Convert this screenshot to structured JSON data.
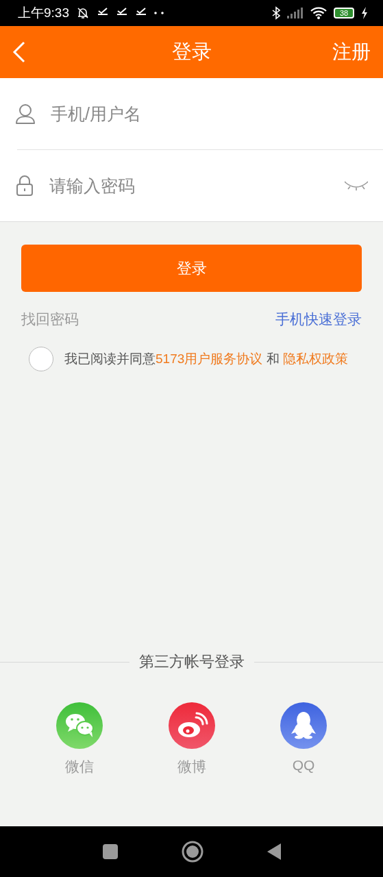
{
  "status_bar": {
    "time": "上午9:33",
    "battery": "38"
  },
  "header": {
    "title": "登录",
    "action": "注册"
  },
  "fields": [
    {
      "kind": "user",
      "placeholder": "手机/用户名"
    },
    {
      "kind": "password",
      "placeholder": "请输入密码"
    }
  ],
  "login_button": "登录",
  "links": {
    "left": "找回密码",
    "right": "手机快速登录"
  },
  "agreement": {
    "checked": false,
    "parts": [
      {
        "kind": "text",
        "text": "我已阅读并同意"
      },
      {
        "kind": "link",
        "text": "5173用户服务协议"
      },
      {
        "kind": "text",
        "text": " 和 "
      },
      {
        "kind": "link",
        "text": "隐私权政策"
      }
    ]
  },
  "third_party": {
    "title": "第三方帐号登录",
    "items": [
      {
        "kind": "wechat",
        "label": "微信"
      },
      {
        "kind": "weibo",
        "label": "微博"
      },
      {
        "kind": "qq",
        "label": "QQ"
      }
    ]
  }
}
